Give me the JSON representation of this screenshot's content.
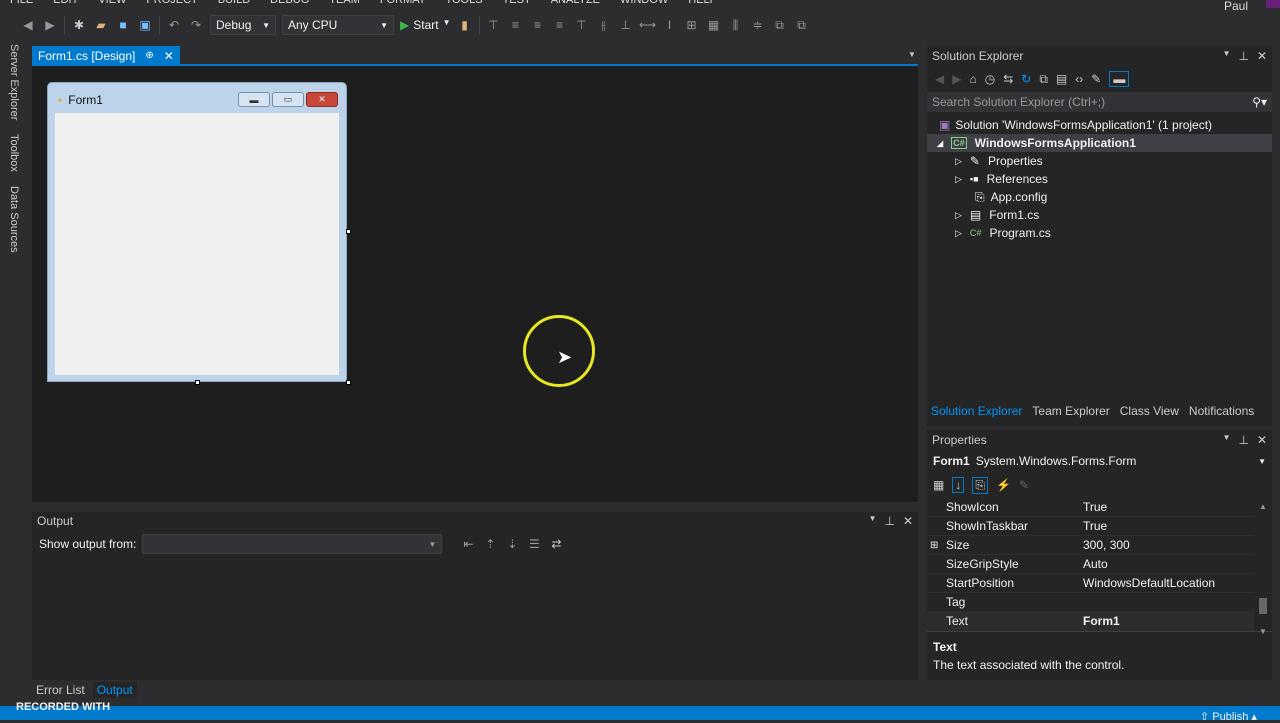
{
  "menu": [
    "FILE",
    "EDIT",
    "VIEW",
    "PROJECT",
    "BUILD",
    "DEBUG",
    "TEAM",
    "FORMAT",
    "TOOLS",
    "TEST",
    "ANALYZE",
    "WINDOW",
    "HELP"
  ],
  "user": "Paul",
  "toolbar": {
    "config": "Debug",
    "platform": "Any CPU",
    "start": "Start"
  },
  "side_tabs": [
    "Server Explorer",
    "Toolbox",
    "Data Sources"
  ],
  "doc_tab": "Form1.cs [Design]",
  "form": {
    "title": "Form1"
  },
  "output": {
    "title": "Output",
    "show_from": "Show output from:",
    "source": ""
  },
  "bottom_tabs": [
    "Error List",
    "Output"
  ],
  "recorded": "RECORDED WITH",
  "publish": "Publish",
  "solution_explorer": {
    "title": "Solution Explorer",
    "search_placeholder": "Search Solution Explorer (Ctrl+;)",
    "solution": "Solution 'WindowsFormsApplication1' (1 project)",
    "project": "WindowsFormsApplication1",
    "items": [
      "Properties",
      "References",
      "App.config",
      "Form1.cs",
      "Program.cs"
    ],
    "tabs": [
      "Solution Explorer",
      "Team Explorer",
      "Class View",
      "Notifications"
    ]
  },
  "properties": {
    "title": "Properties",
    "object": "Form1",
    "type": "System.Windows.Forms.Form",
    "rows": [
      {
        "name": "ShowIcon",
        "value": "True"
      },
      {
        "name": "ShowInTaskbar",
        "value": "True"
      },
      {
        "name": "Size",
        "value": "300, 300"
      },
      {
        "name": "SizeGripStyle",
        "value": "Auto"
      },
      {
        "name": "StartPosition",
        "value": "WindowsDefaultLocation"
      },
      {
        "name": "Tag",
        "value": ""
      },
      {
        "name": "Text",
        "value": "Form1"
      }
    ],
    "desc_title": "Text",
    "desc": "The text associated with the control."
  }
}
